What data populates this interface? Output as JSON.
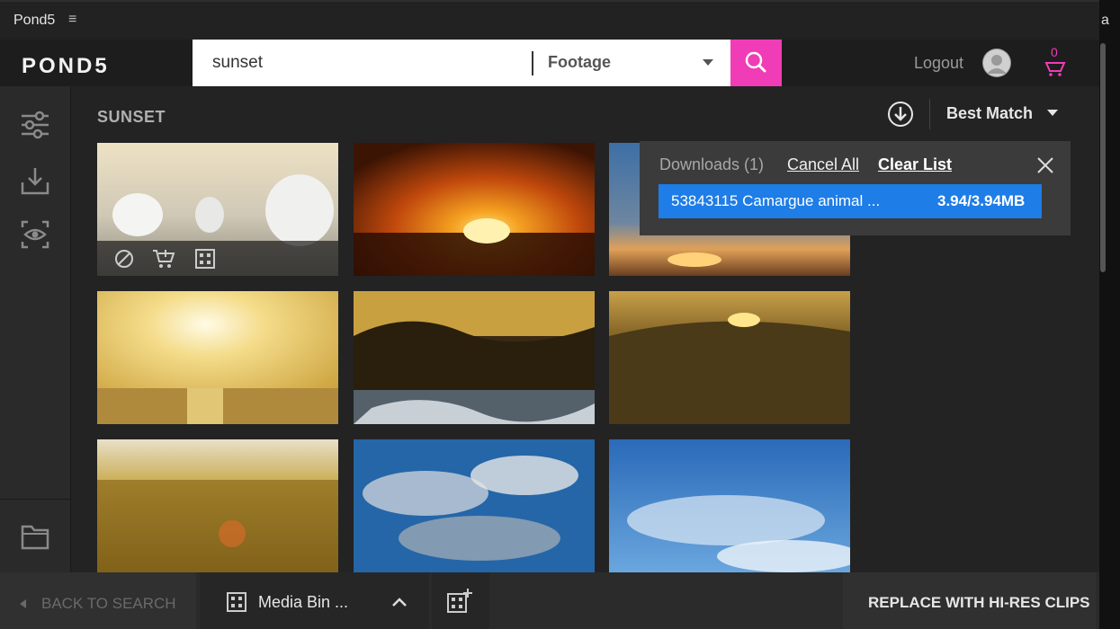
{
  "panel": {
    "title": "Pond5",
    "menu_icon": "hamburger-icon"
  },
  "edge_text": "a",
  "header": {
    "logo": "POND5",
    "search_value": "sunset",
    "media_type": "Footage",
    "logout": "Logout",
    "cart_count": "0"
  },
  "content": {
    "heading": "SUNSET",
    "sort": "Best Match"
  },
  "downloads": {
    "label": "Downloads (1)",
    "cancel_all": "Cancel All",
    "clear_list": "Clear List",
    "item_name": "53843115 Camargue animal ...",
    "item_size": "3.94/3.94MB"
  },
  "thumbnails": [
    {
      "subject": "white horses running on beach"
    },
    {
      "subject": "orange sunset over clouds"
    },
    {
      "subject": "sunset sky over clouds"
    },
    {
      "subject": "sun over sea"
    },
    {
      "subject": "plants in water at sunset"
    },
    {
      "subject": "hills with trees at sunset"
    },
    {
      "subject": "wheat field at sunset"
    },
    {
      "subject": "clouds blue sky"
    },
    {
      "subject": "blue sky clouds"
    }
  ],
  "footer": {
    "back": "BACK TO SEARCH",
    "media_bin": "Media Bin ...",
    "replace": "REPLACE WITH HI-RES CLIPS"
  },
  "colors": {
    "accent": "#f03cb6",
    "download_blue": "#1e7de6"
  }
}
